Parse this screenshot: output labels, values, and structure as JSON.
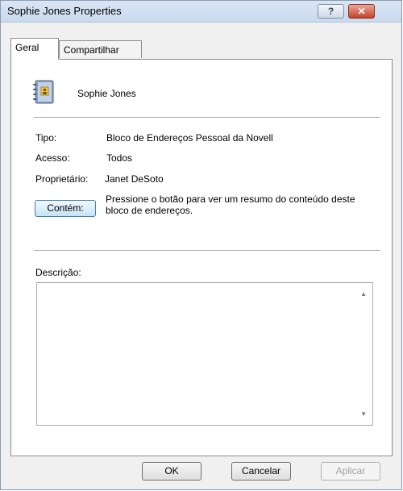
{
  "window": {
    "title": "Sophie Jones Properties",
    "help_label": "?",
    "close_label": "✕"
  },
  "tabs": [
    {
      "label": "Geral",
      "active": true
    },
    {
      "label": "Compartilhar",
      "active": false
    }
  ],
  "general": {
    "icon": "address-book-icon",
    "name": "Sophie Jones",
    "fields": [
      {
        "label": "Tipo:",
        "value": "Bloco de Endereços Pessoal da Novell"
      },
      {
        "label": "Acesso:",
        "value": "Todos"
      },
      {
        "label": "Proprietário:",
        "value": "Janet DeSoto"
      }
    ],
    "contains_button": "Contém:",
    "contains_desc": "Pressione o botão para ver um resumo do conteúdo deste bloco de endereços.",
    "description_label": "Descrição:",
    "description_value": ""
  },
  "footer": {
    "ok": "OK",
    "cancel": "Cancelar",
    "apply": "Aplicar"
  },
  "colors": {
    "titlebar": "#c9d9ee",
    "close_button": "#c4412b",
    "accent_button": "#3c7fb1"
  }
}
